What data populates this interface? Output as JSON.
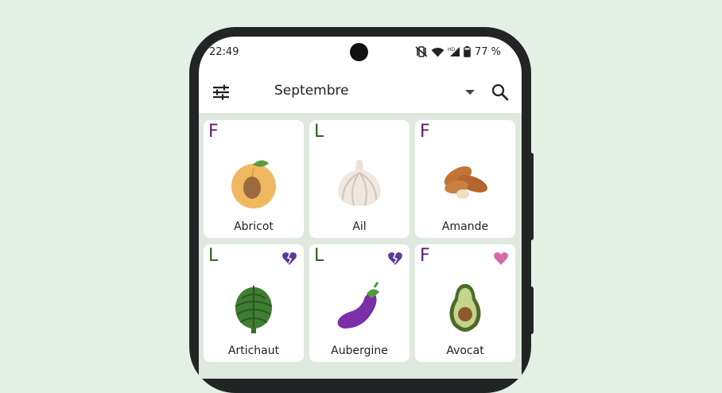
{
  "status_bar": {
    "time": "22:49",
    "battery": "77 %",
    "network_label": "HD"
  },
  "app_bar": {
    "month": "Septembre"
  },
  "cards": [
    {
      "season": "F",
      "name": "Abricot",
      "badge": "",
      "icon": "apricot-icon"
    },
    {
      "season": "L",
      "name": "Ail",
      "badge": "",
      "icon": "garlic-icon"
    },
    {
      "season": "F",
      "name": "Amande",
      "badge": "",
      "icon": "almond-icon"
    },
    {
      "season": "L",
      "name": "Artichaut",
      "badge": "broken-heart",
      "icon": "artichoke-icon"
    },
    {
      "season": "L",
      "name": "Aubergine",
      "badge": "broken-heart",
      "icon": "eggplant-icon"
    },
    {
      "season": "F",
      "name": "Avocat",
      "badge": "heart",
      "icon": "avocado-icon"
    }
  ],
  "colors": {
    "background": "#e3f1e5",
    "fruit_letter": "#5a1d6d",
    "vegetable_letter": "#2c5c1c",
    "broken_heart": "#5b3a9c",
    "heart": "#d86aa6"
  }
}
